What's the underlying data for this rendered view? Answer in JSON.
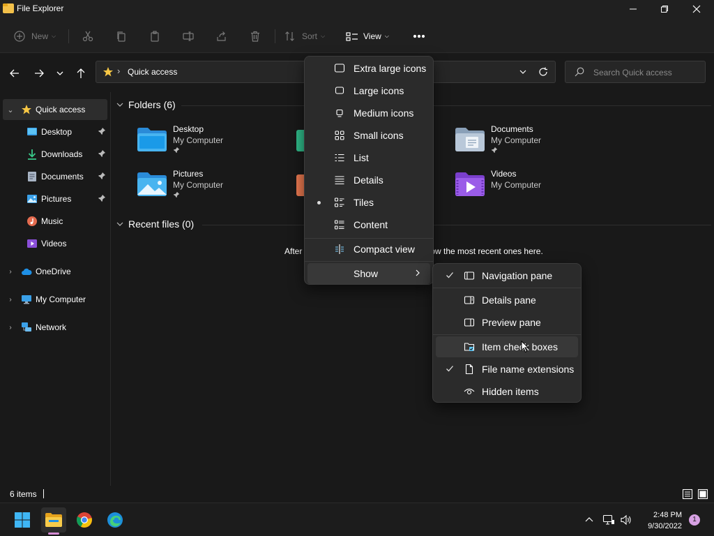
{
  "window": {
    "title": "File Explorer"
  },
  "toolbar": {
    "new_label": "New",
    "sort_label": "Sort",
    "view_label": "View"
  },
  "address": {
    "path": "Quick access"
  },
  "search": {
    "placeholder": "Search Quick access"
  },
  "sidebar": {
    "items": [
      {
        "label": "Quick access"
      },
      {
        "label": "Desktop"
      },
      {
        "label": "Downloads"
      },
      {
        "label": "Documents"
      },
      {
        "label": "Pictures"
      },
      {
        "label": "Music"
      },
      {
        "label": "Videos"
      },
      {
        "label": "OneDrive"
      },
      {
        "label": "My Computer"
      },
      {
        "label": "Network"
      }
    ]
  },
  "main": {
    "folders_header": "Folders (6)",
    "recent_header": "Recent files (0)",
    "recent_empty": "After you've opened some files, we'll show the most recent ones here.",
    "tiles": [
      {
        "name": "Desktop",
        "location": "My Computer"
      },
      {
        "name": "Documents",
        "location": "My Computer"
      },
      {
        "name": "Pictures",
        "location": "My Computer"
      },
      {
        "name": "Videos",
        "location": "My Computer"
      }
    ]
  },
  "view_menu": {
    "items": [
      {
        "label": "Extra large icons"
      },
      {
        "label": "Large icons"
      },
      {
        "label": "Medium icons"
      },
      {
        "label": "Small icons"
      },
      {
        "label": "List"
      },
      {
        "label": "Details"
      },
      {
        "label": "Tiles"
      },
      {
        "label": "Content"
      },
      {
        "label": "Compact view"
      },
      {
        "label": "Show"
      }
    ]
  },
  "show_menu": {
    "items": [
      {
        "label": "Navigation pane"
      },
      {
        "label": "Details pane"
      },
      {
        "label": "Preview pane"
      },
      {
        "label": "Item check boxes"
      },
      {
        "label": "File name extensions"
      },
      {
        "label": "Hidden items"
      }
    ]
  },
  "status": {
    "count": "6 items"
  },
  "taskbar": {
    "time": "2:48 PM",
    "date": "9/30/2022",
    "notifications": "1"
  },
  "colors": {
    "accent": "#60cdff",
    "menu_bg": "#2b2b2b",
    "folder_blue": "#3aa0e8"
  }
}
